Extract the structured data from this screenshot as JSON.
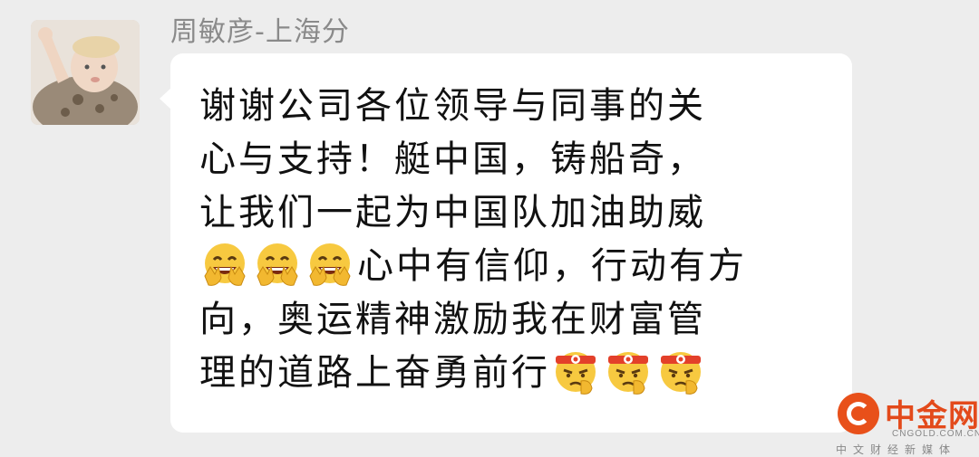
{
  "message": {
    "sender_name": "周敏彦-上海分",
    "avatar": "baby-photo",
    "lines": [
      "谢谢公司各位领导与同事的关",
      "心与支持！艇中国，铸船奇，",
      "让我们一起为中国队加油助威",
      "心中有信仰，行动有方",
      "向，奥运精神激励我在财富管",
      "理的道路上奋勇前行"
    ],
    "emojis": {
      "victory_face": "grinning-face-with-victory-hands",
      "determined_face": "face-with-headband-fist"
    }
  },
  "watermark": {
    "name": "中金网",
    "domain": "CNGOLD.COM.CN",
    "tagline": "中文财经新媒体",
    "color": "#e34a1b"
  }
}
